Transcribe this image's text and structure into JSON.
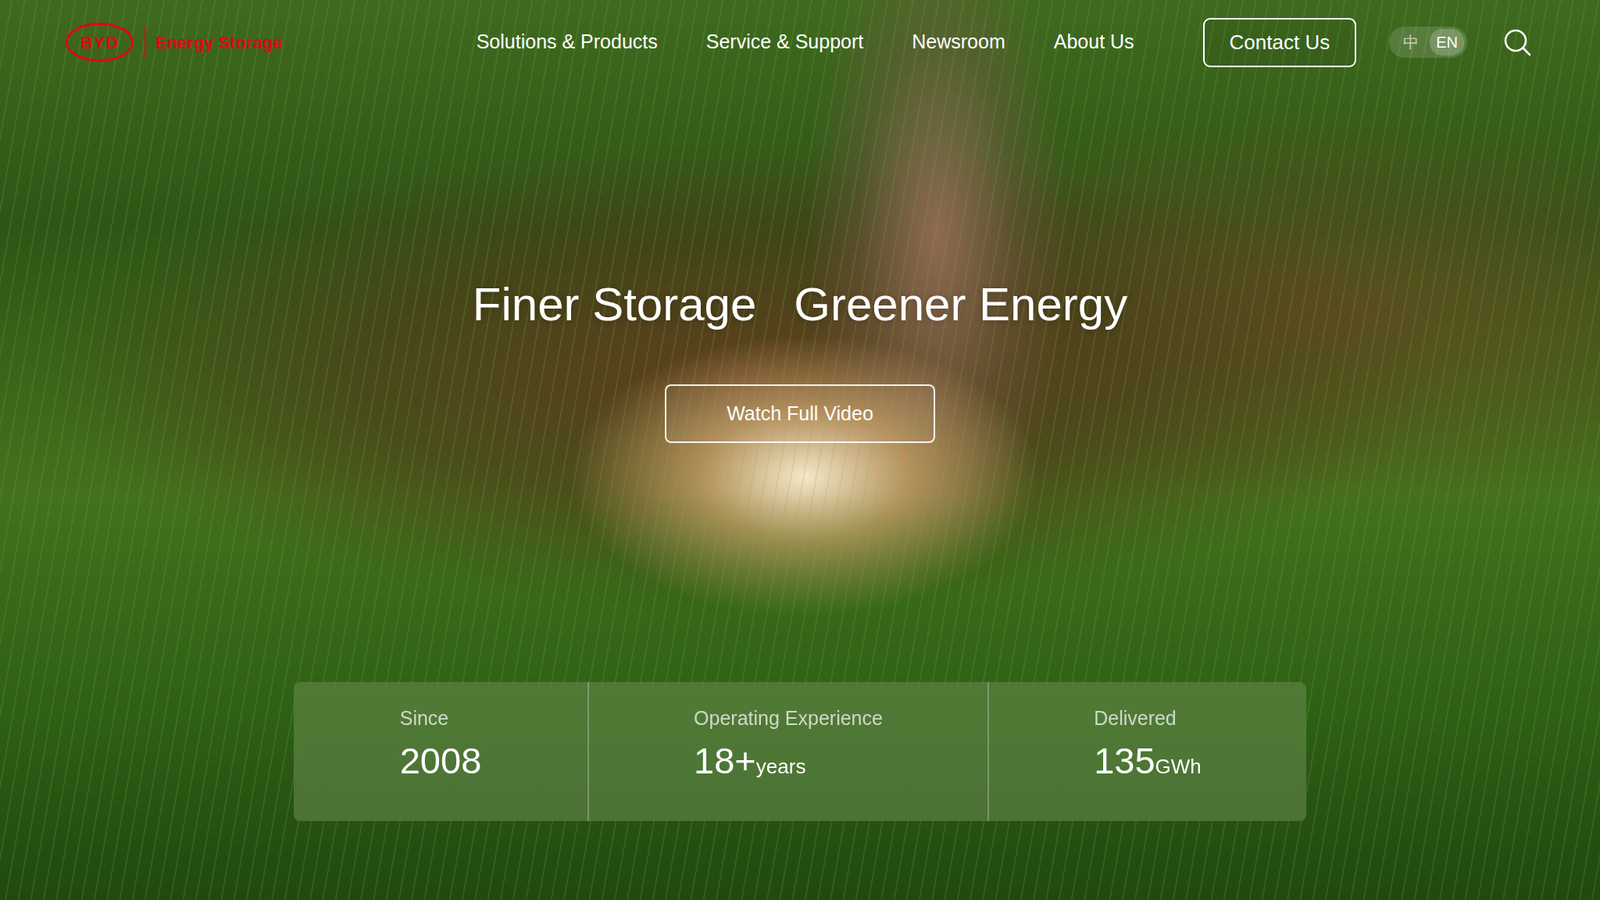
{
  "header": {
    "logo_mark": "BYD",
    "logo_text": "Energy Storage",
    "nav": [
      "Solutions & Products",
      "Service & Support",
      "Newsroom",
      "About Us"
    ],
    "contact_button": "Contact Us",
    "languages": [
      {
        "label": "中",
        "selected": false
      },
      {
        "label": "EN",
        "selected": true
      }
    ]
  },
  "hero": {
    "title_parts": [
      "Finer Storage",
      "Greener Energy"
    ],
    "video_button": "Watch Full Video"
  },
  "stats": [
    {
      "label": "Since",
      "value": "2008",
      "unit": ""
    },
    {
      "label": "Operating Experience",
      "value": "18+",
      "unit": "years"
    },
    {
      "label": "Delivered",
      "value": "135",
      "unit": "GWh"
    }
  ]
}
